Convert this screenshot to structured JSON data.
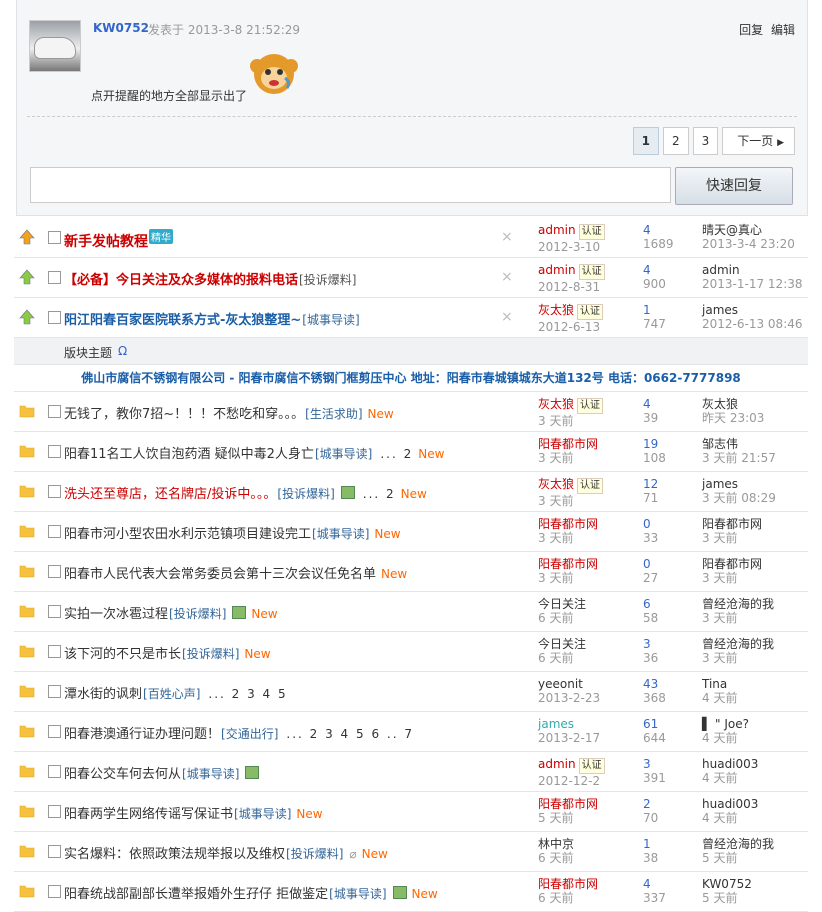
{
  "post": {
    "author": "KW0752",
    "posted_label": "发表于",
    "posted_time": "2013-3-8 21:52:29",
    "reply_label": "回复",
    "edit_label": "编辑",
    "content": "点开提醒的地方全部显示出了"
  },
  "pager": {
    "pages": [
      "1",
      "2",
      "3"
    ],
    "next_label": "下一页"
  },
  "reply_button": "快速回复",
  "section": {
    "title": "版块主题",
    "refresh_glyph": "Ω"
  },
  "ad_text": "佛山市腐信不锈钢有限公司 - 阳春市腐信不锈钢门框剪压中心 地址：阳春市春城镇城东大道132号 电话：0662-7777898",
  "sticky": [
    {
      "title": "新手发帖教程",
      "type": "",
      "jing": "精华",
      "author": "admin",
      "cert": "认证",
      "date": "2012-3-10",
      "replies": "4",
      "views": "1689",
      "last_user": "晴天@真心",
      "last_time": "2013-3-4 23:20"
    },
    {
      "title": "【必备】今日关注及众多媒体的报料电话",
      "type": "[投诉爆料]",
      "author": "admin",
      "cert": "认证",
      "date": "2012-8-31",
      "replies": "4",
      "views": "900",
      "last_user": "admin",
      "last_time": "2013-1-17 12:38"
    },
    {
      "title": "阳江阳春百家医院联系方式-灰太狼整理~",
      "type": "[城事导读]",
      "author": "灰太狼",
      "cert": "认证",
      "date": "2012-6-13",
      "replies": "1",
      "views": "747",
      "last_user": "james",
      "last_time": "2012-6-13 08:46"
    }
  ],
  "threads": [
    {
      "title": "无钱了，教你7招~！！！不愁吃和穿。。。",
      "type": "[生活求助]",
      "new": "New",
      "author": "灰太狼",
      "cert": "认证",
      "date": "3 天前",
      "replies": "4",
      "views": "39",
      "last_user": "灰太狼",
      "last_time": "昨天 23:03"
    },
    {
      "title": "阳春11名工人饮自泡药酒 疑似中毒2人身亡",
      "type": "[城事导读]",
      "pages": "... 2",
      "new": "New",
      "author": "阳春都市网",
      "date": "3 天前",
      "replies": "19",
      "views": "108",
      "last_user": "邹志伟",
      "last_time": "3 天前 21:57"
    },
    {
      "title": "洗头还至尊店，还名牌店/投诉中。。。",
      "type": "[投诉爆料]",
      "img": true,
      "pages": "... 2",
      "new": "New",
      "author": "灰太狼",
      "cert": "认证",
      "date": "3 天前",
      "replies": "12",
      "views": "71",
      "last_user": "james",
      "last_time": "3 天前 08:29"
    },
    {
      "title": "阳春市河小型农田水利示范镇项目建设完工",
      "type": "[城事导读]",
      "new": "New",
      "author": "阳春都市网",
      "date": "3 天前",
      "replies": "0",
      "views": "33",
      "last_user": "阳春都市网",
      "last_time": "3 天前"
    },
    {
      "title": "阳春市人民代表大会常务委员会第十三次会议任免名单",
      "type": "",
      "new": "New",
      "author": "阳春都市网",
      "date": "3 天前",
      "replies": "0",
      "views": "27",
      "last_user": "阳春都市网",
      "last_time": "3 天前"
    },
    {
      "title": "实拍一次冰雹过程",
      "type": "[投诉爆料]",
      "img": true,
      "new": "New",
      "author": "今日关注",
      "date": "6 天前",
      "replies": "6",
      "views": "58",
      "last_user": "曾经沧海的我",
      "last_time": "3 天前"
    },
    {
      "title": "该下河的不只是市长",
      "type": "[投诉爆料]",
      "new": "New",
      "author": "今日关注",
      "date": "6 天前",
      "replies": "3",
      "views": "36",
      "last_user": "曾经沧海的我",
      "last_time": "3 天前"
    },
    {
      "title": "潭水街的讽刺",
      "type": "[百姓心声]",
      "pages": "... 2 3 4 5",
      "author": "yeeonit",
      "date": "2013-2-23",
      "replies": "43",
      "views": "368",
      "last_user": "Tina",
      "last_time": "4 天前"
    },
    {
      "title": "阳春港澳通行证办理问题！",
      "type": "[交通出行]",
      "pages": "... 2 3 4 5 6 .. 7",
      "author": "james",
      "date": "2013-2-17",
      "replies": "61",
      "views": "644",
      "last_user": "▌ \" Joe?",
      "last_time": "4 天前"
    },
    {
      "title": "阳春公交车何去何从",
      "type": "[城事导读]",
      "img": true,
      "author": "admin",
      "cert": "认证",
      "date": "2012-12-2",
      "replies": "3",
      "views": "391",
      "last_user": "huadi003",
      "last_time": "4 天前"
    },
    {
      "title": "阳春两学生网络传谣写保证书",
      "type": "[城事导读]",
      "new": "New",
      "author": "阳春都市网",
      "date": "5 天前",
      "replies": "2",
      "views": "70",
      "last_user": "huadi003",
      "last_time": "4 天前"
    },
    {
      "title": "实名爆料：依照政策法规举报以及维权",
      "type": "[投诉爆料]",
      "clip": true,
      "new": "New",
      "author": "林中京",
      "date": "6 天前",
      "replies": "1",
      "views": "38",
      "last_user": "曾经沧海的我",
      "last_time": "5 天前"
    },
    {
      "title": "阳春统战部副部长遭举报婚外生孖仔 拒做鉴定",
      "type": "[城事导读]",
      "img": true,
      "new": "New",
      "author": "阳春都市网",
      "date": "6 天前",
      "replies": "4",
      "views": "337",
      "last_user": "KW0752",
      "last_time": "5 天前"
    }
  ],
  "colors": {
    "accent": "#1a5ea8",
    "alert": "#cc0000",
    "new_tag": "#ff6600"
  }
}
